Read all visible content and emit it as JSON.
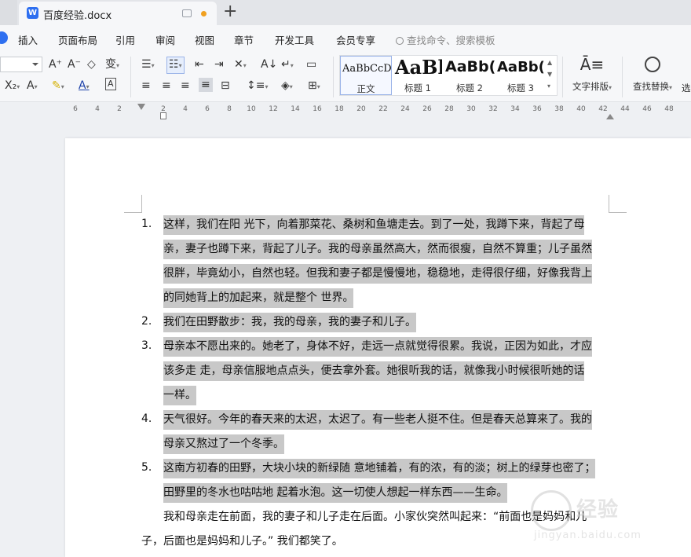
{
  "titlebar": {
    "doc_name": "百度经验.docx",
    "doc_icon_letter": "W",
    "new_tab": "+"
  },
  "menu": {
    "items": [
      "插入",
      "页面布局",
      "引用",
      "审阅",
      "视图",
      "章节",
      "开发工具",
      "会员专享"
    ],
    "search_placeholder": "查找命令、搜索模板"
  },
  "ribbon": {
    "styles": [
      {
        "sample": "AaBbCcD",
        "name": "正文"
      },
      {
        "sample": "AaBl",
        "name": "标题 1"
      },
      {
        "sample": "AaBb(",
        "name": "标题 2"
      },
      {
        "sample": "AaBb(",
        "name": "标题 3"
      }
    ],
    "text_layout": "文字排版",
    "find_replace": "查找替换",
    "select_stub": "选"
  },
  "ruler": {
    "ticks": [
      "6",
      "4",
      "2",
      "2",
      "4",
      "6",
      "8",
      "10",
      "12",
      "14",
      "16",
      "18",
      "20",
      "22",
      "24",
      "26",
      "28",
      "30",
      "32",
      "34",
      "36",
      "38",
      "40",
      "42",
      "44",
      "46",
      "48"
    ]
  },
  "document": {
    "items": [
      {
        "num": "1.",
        "lines": [
          "这样，我们在阳 光下，向着那菜花、桑树和鱼塘走去。到了一处，我蹲下来，背起了母",
          "亲，妻子也蹲下来，背起了儿子。我的母亲虽然高大，然而很瘦，自然不算重；儿子虽然",
          "很胖，毕竟幼小，自然也轻。但我和妻子都是慢慢地，稳稳地，走得很仔细，好像我背上",
          "的同她背上的加起来，就是整个 世界。"
        ]
      },
      {
        "num": "2.",
        "lines": [
          "我们在田野散步：我，我的母亲，我的妻子和儿子。"
        ]
      },
      {
        "num": "3.",
        "lines": [
          "母亲本不愿出来的。她老了，身体不好，走远一点就觉得很累。我说，正因为如此，才应",
          "该多走 走，母亲信服地点点头，便去拿外套。她很听我的话，就像我小时候很听她的话",
          "一样。"
        ]
      },
      {
        "num": "4.",
        "lines": [
          "天气很好。今年的春天来的太迟，太迟了。有一些老人挺不住。但是春天总算来了。我的",
          "母亲又熬过了一个冬季。"
        ]
      },
      {
        "num": "5.",
        "lines": [
          "这南方初春的田野，大块小块的新绿随 意地铺着，有的浓，有的淡；树上的绿芽也密了；",
          "田野里的冬水也咕咕地 起着水泡。这一切使人想起一样东西——生命。"
        ]
      }
    ],
    "para": [
      "我和母亲走在前面，我的妻子和儿子走在后面。小家伙突然叫起来：“前面也是妈妈和儿",
      "子，后面也是妈妈和儿子。” 我们都笑了。"
    ]
  },
  "watermark": {
    "text": "经验",
    "sub": "jingyan.baidu.com"
  },
  "colors": {
    "accent": "#2e6ff0",
    "highlight": "#c8c8c8",
    "modified": "#f0a020"
  }
}
